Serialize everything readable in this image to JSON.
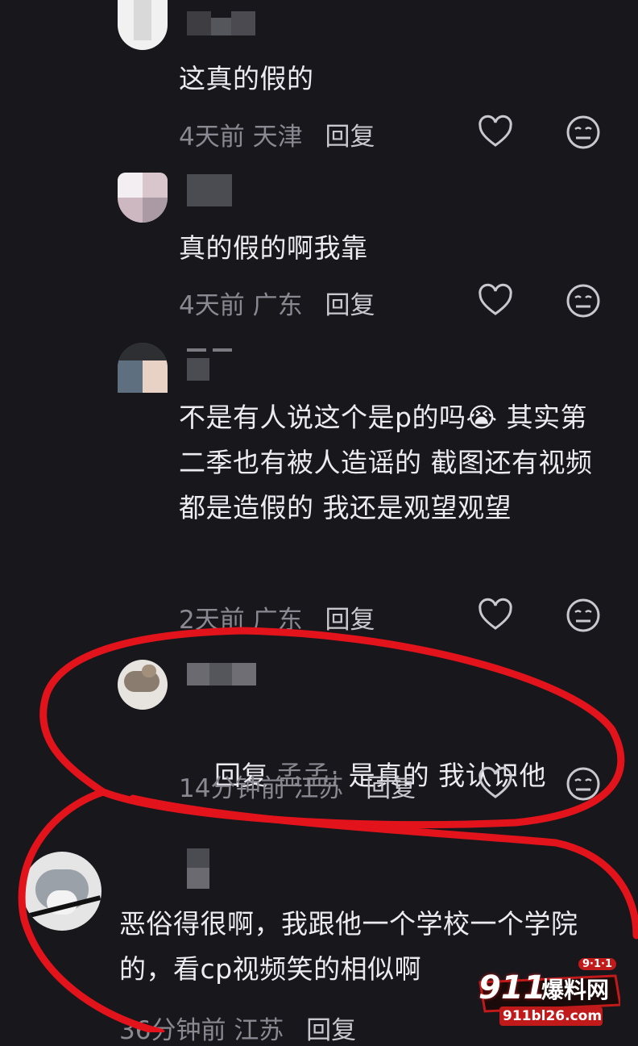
{
  "comments": [
    {
      "text": "这真的假的",
      "time": "4天前",
      "location": "天津",
      "reply": "回复"
    },
    {
      "text": "真的假的啊我靠",
      "time": "4天前",
      "location": "广东",
      "reply": "回复"
    },
    {
      "text": "不是有人说这个是p的吗😭 其实第二季也有被人造谣的 截图还有视频都是造假的 我还是观望观望",
      "time": "2天前",
      "location": "广东",
      "reply": "回复"
    },
    {
      "reply_prefix": "回复",
      "reply_target": "孟孟:",
      "text": "是真的 我认识他",
      "time": "14分钟前",
      "location": "江苏",
      "reply": "回复"
    },
    {
      "text": "恶俗得很啊，我跟他一个学校一个学院的，看cp视频笑的相似啊",
      "time": "36分钟前",
      "location": "江苏",
      "reply": "回复"
    }
  ],
  "icons": {
    "like": "heart-outline-icon",
    "dislike": "meh-face-icon"
  },
  "watermark": {
    "number": "911",
    "name": "爆料网",
    "domain": "911bl26.com",
    "badge": "9·1·1"
  },
  "colors": {
    "background": "#18171c",
    "text": "#ecebef",
    "meta": "#8a8992",
    "annotation": "#e3131b"
  }
}
